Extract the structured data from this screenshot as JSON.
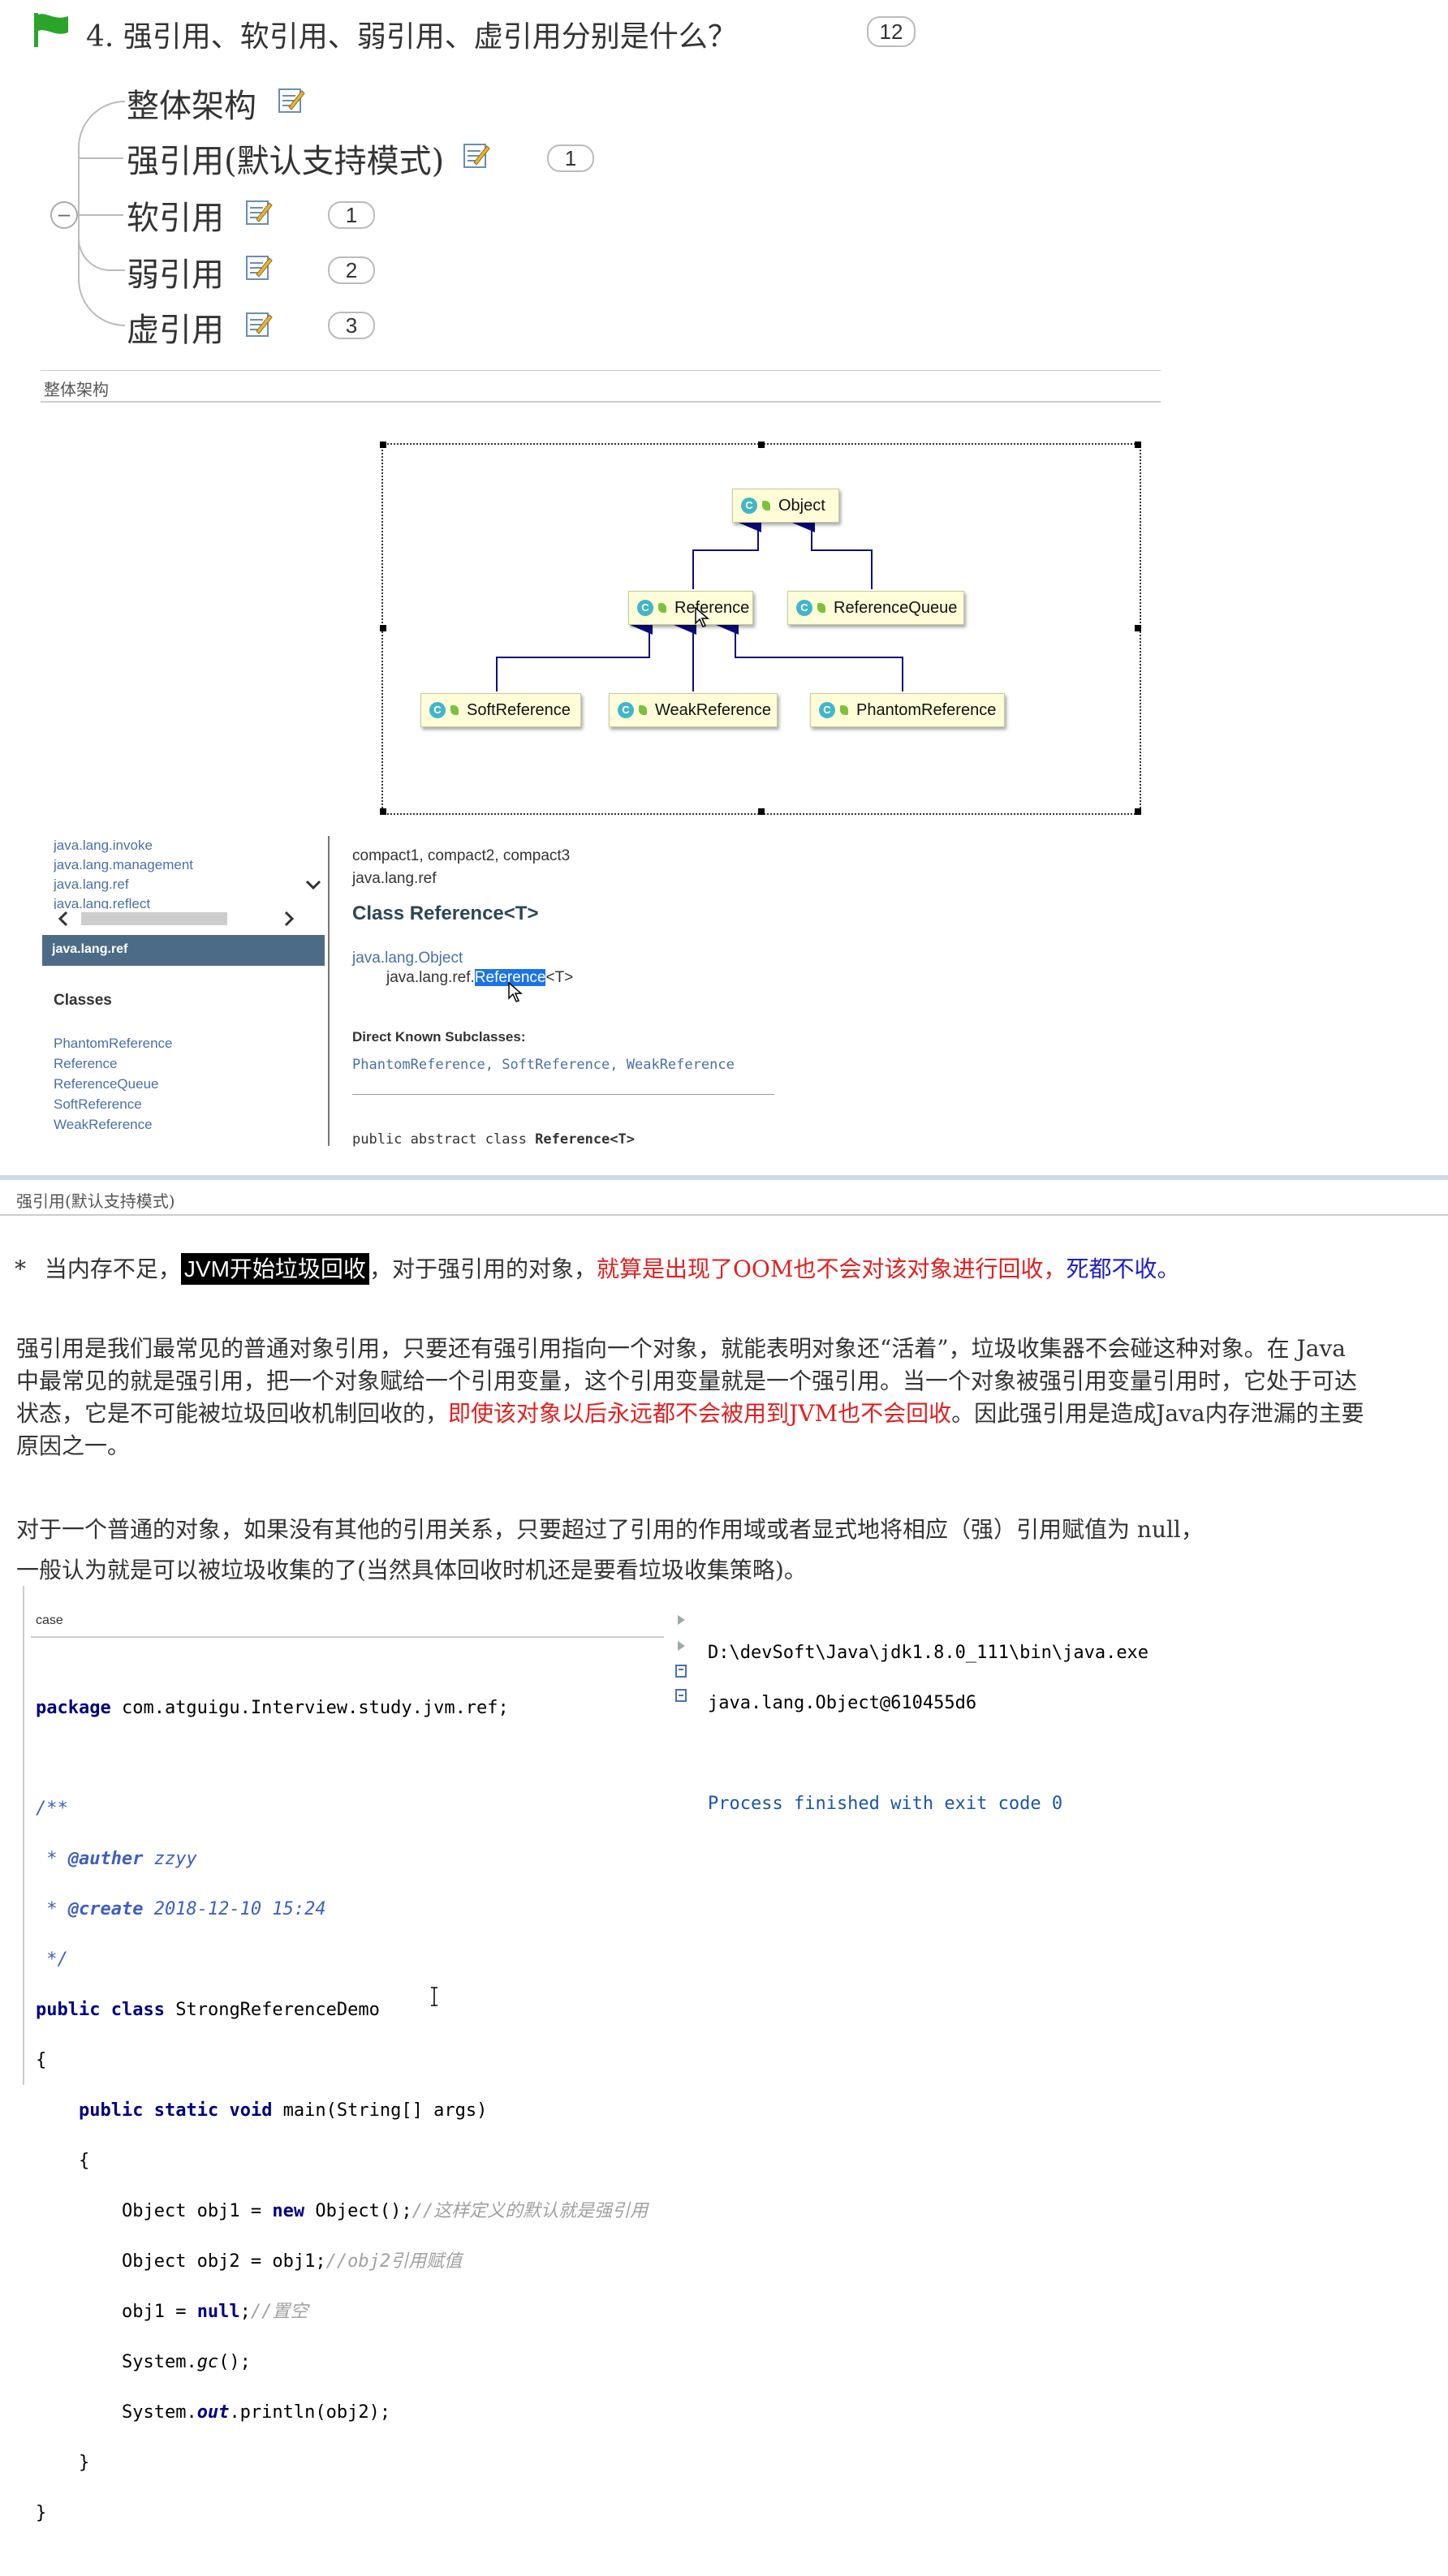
{
  "question": {
    "title": "4. 强引用、软引用、弱引用、虚引用分别是什么？",
    "count": "12"
  },
  "mindmap": {
    "collapse_symbol": "–",
    "topics": [
      {
        "label": "整体架构",
        "badge": ""
      },
      {
        "label": "强引用(默认支持模式)",
        "badge": "1"
      },
      {
        "label": "软引用",
        "badge": "1"
      },
      {
        "label": "弱引用",
        "badge": "2"
      },
      {
        "label": "虚引用",
        "badge": "3"
      }
    ]
  },
  "section1": {
    "label": "整体架构"
  },
  "uml": {
    "c_glyph": "C",
    "object": "Object",
    "reference": "Reference",
    "reference_queue": "ReferenceQueue",
    "soft": "SoftReference",
    "weak": "WeakReference",
    "phantom": "PhantomReference"
  },
  "javadoc": {
    "packages": [
      "java.lang.invoke",
      "java.lang.management",
      "java.lang.ref",
      "java.lang.reflect"
    ],
    "selected_package": "java.lang.ref",
    "classes_heading": "Classes",
    "classes": [
      "PhantomReference",
      "Reference",
      "ReferenceQueue",
      "SoftReference",
      "WeakReference"
    ],
    "profiles": "compact1, compact2, compact3",
    "package_name": "java.lang.ref",
    "class_title": "Class Reference<T>",
    "hier_parent": "java.lang.Object",
    "hier_prefix": "java.lang.ref.",
    "hier_highlight": "Reference",
    "hier_suffix": "<T>",
    "subclasses_heading": "Direct Known Subclasses:",
    "subclasses": "PhantomReference, SoftReference, WeakReference",
    "decl_prefix": "public abstract class ",
    "decl_name": "Reference<T>"
  },
  "section2": {
    "label": "强引用(默认支持模式)"
  },
  "bullet": {
    "star": "*",
    "p1": "当内存不足，",
    "highlight": "JVM开始垃圾回收",
    "p2": "，对于强引用的对象，",
    "red": "就算是出现了OOM也不会对该对象进行回收，",
    "blue": "死都不收。"
  },
  "para1": {
    "l1": "强引用是我们最常见的普通对象引用，只要还有强引用指向一个对象，就能表明对象还“活着”，垃圾收集器不会碰这种对象。在 Java",
    "l2": "中最常见的就是强引用，把一个对象赋给一个引用变量，这个引用变量就是一个强引用。当一个对象被强引用变量引用时，它处于可达",
    "l3a": "状态，它是不可能被垃圾回收机制回收的，",
    "l3red": "即使该对象以后永远都不会被用到JVM也不会回收",
    "l3b": "。因此强引用是造成Java内存泄漏的主要",
    "l4": "原因之一。"
  },
  "para2": {
    "l1": "对于一个普通的对象，如果没有其他的引用关系，只要超过了引用的作用域或者显式地将相应（强）引用赋值为 null，",
    "l2": "一般认为就是可以被垃圾收集的了(当然具体回收时机还是要看垃圾收集策略)。"
  },
  "code": {
    "label": "case",
    "kw_package": "package",
    "package_name": " com.atguigu.Interview.study.jvm.ref;",
    "doc_open": "/**",
    "doc_star1": " * ",
    "doc_tag1": "@auther",
    "doc_val1": " zzyy",
    "doc_star2": " * ",
    "doc_tag2": "@create",
    "doc_val2": " 2018-12-10 15:24",
    "doc_close": " */",
    "kw_public": "public",
    "kw_class": "class",
    "class_name": " StrongReferenceDemo",
    "brace_open": "{",
    "kw_public2": "public",
    "kw_static": "static",
    "kw_void": "void",
    "main_sig": " main(String[] args)",
    "brace_open2": "{",
    "l1a": "Object obj1 = ",
    "l1kw": "new",
    "l1b": " Object();",
    "l1c": "//这样定义的默认就是强引用",
    "l2a": "Object obj2 = obj1;",
    "l2c": "//obj2引用赋值",
    "l3a": "obj1 = ",
    "l3kw": "null",
    "l3b": ";",
    "l3c": "//置空",
    "l4a": "System.",
    "l4b": "gc",
    "l4c": "();",
    "l5a": "System.",
    "l5b": "out",
    "l5c": ".println(obj2);",
    "brace_close2": "}",
    "brace_close": "}"
  },
  "console": {
    "line1": "D:\\devSoft\\Java\\jdk1.8.0_111\\bin\\java.exe",
    "line2": "java.lang.Object@610455d6",
    "line3": "Process finished with exit code 0"
  },
  "colors": {
    "red": "#e02020",
    "blue": "#2020c0",
    "highlight_bg": "#000000",
    "selection": "#1a73e8"
  }
}
